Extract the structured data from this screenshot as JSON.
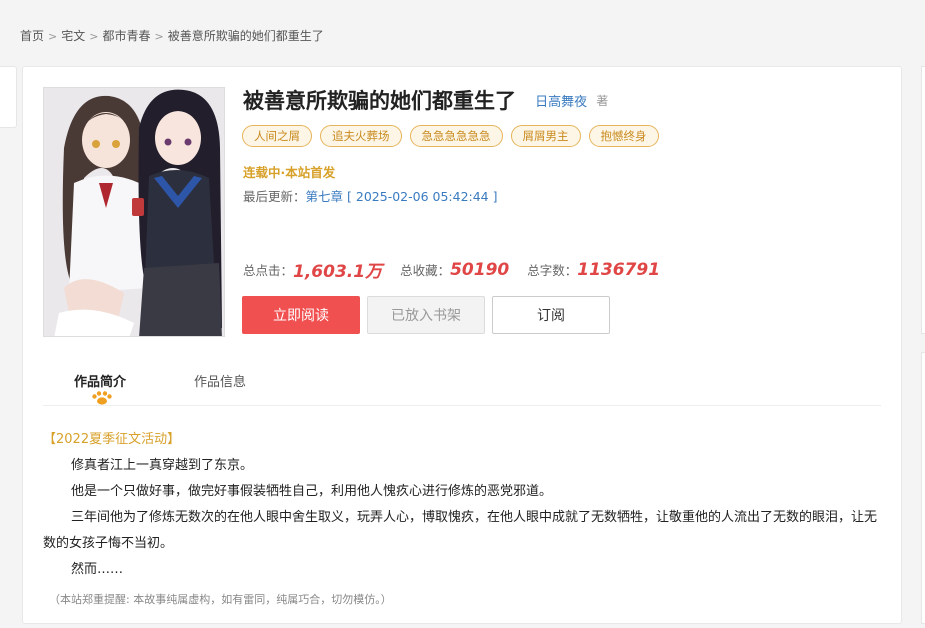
{
  "breadcrumb": {
    "items": [
      "首页",
      "宅文",
      "都市青春"
    ],
    "separator": ">",
    "current": "被善意所欺骗的她们都重生了"
  },
  "book": {
    "title": "被善意所欺骗的她们都重生了",
    "author": "日高舞夜",
    "author_suffix": "著",
    "tags": [
      "人间之屑",
      "追夫火葬场",
      "急急急急急急",
      "屑屑男主",
      "抱憾终身"
    ],
    "status": "连载中·本站首发",
    "update_label": "最后更新：",
    "latest_chapter": "第七章",
    "update_time": "[ 2025-02-06 05:42:44 ]"
  },
  "stats": {
    "clicks_label": "总点击：",
    "clicks": "1,603.1万",
    "favorites_label": "总收藏：",
    "favorites": "50190",
    "words_label": "总字数：",
    "words": "1136791"
  },
  "buttons": {
    "read": "立即阅读",
    "shelf": "已放入书架",
    "subscribe": "订阅"
  },
  "tabs": {
    "intro": "作品简介",
    "info": "作品信息"
  },
  "intro": {
    "activity": "【2022夏季征文活动】",
    "paragraphs": [
      "修真者江上一真穿越到了东京。",
      "他是一个只做好事，做完好事假装牺牲自己，利用他人愧疚心进行修炼的恶党邪道。",
      "三年间他为了修炼无数次的在他人眼中舍生取义，玩弄人心，博取愧疚，在他人眼中成就了无数牺牲，让敬重他的人流出了无数的眼泪，让无数的女孩子悔不当初。",
      "然而……"
    ],
    "note": "（本站郑重提醒: 本故事纯属虚构，如有雷同，纯属巧合，切勿模仿。）"
  },
  "colors": {
    "accent_red": "#f05050",
    "tag_gold": "#d7a12a",
    "link_blue": "#3a7bc0"
  }
}
